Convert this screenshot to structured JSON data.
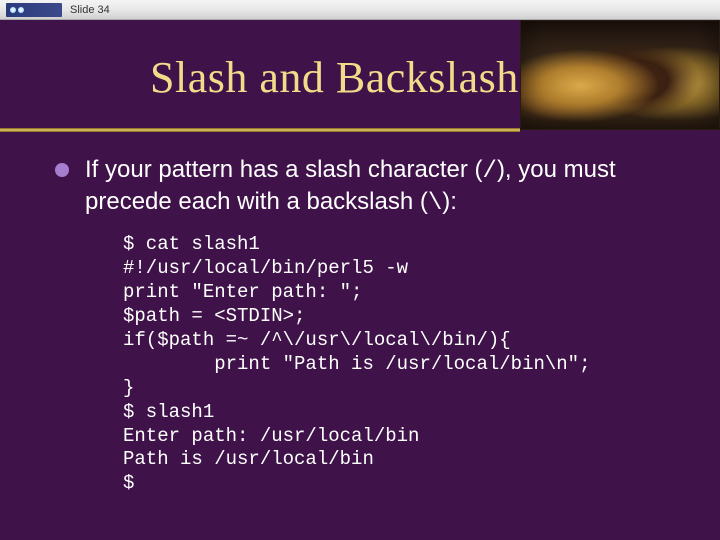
{
  "topbar": {
    "slide_label": "Slide 34"
  },
  "title": "Slash and Backslash",
  "bullet": {
    "text_before": "If your pattern has a slash character (",
    "slash_char": "/",
    "text_middle": "), you must precede each with a backslash (",
    "backslash_char": "\\",
    "text_after": "):"
  },
  "code": {
    "l1": "$ cat slash1",
    "l2": "#!/usr/local/bin/perl5 -w",
    "l3": "print \"Enter path: \";",
    "l4": "$path = <STDIN>;",
    "l5": "if($path =~ /^\\/usr\\/local\\/bin/){",
    "l6": "        print \"Path is /usr/local/bin\\n\";",
    "l7": "}",
    "l8": "$ slash1",
    "l9": "Enter path: /usr/local/bin",
    "l10": "Path is /usr/local/bin",
    "l11": "$"
  }
}
